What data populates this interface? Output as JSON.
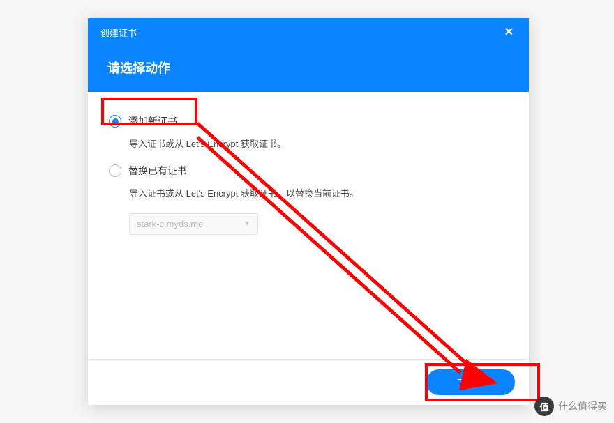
{
  "modal": {
    "breadcrumb": "创建证书",
    "title": "请选择动作",
    "option1": {
      "label": "添加新证书",
      "desc": "导入证书或从 Let's Encrypt 获取证书。"
    },
    "option2": {
      "label": "替换已有证书",
      "desc": "导入证书或从 Let's Encrypt 获取证书，以替换当前证书。"
    },
    "dropdown": {
      "value": "stark-c.myds.me"
    },
    "next": "下一步"
  },
  "watermark": {
    "logo": "值",
    "text": "什么值得买"
  }
}
